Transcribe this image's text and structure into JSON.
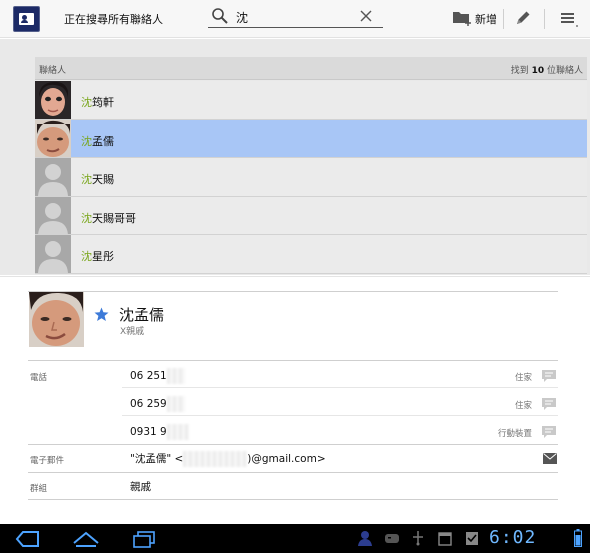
{
  "action_bar": {
    "title": "正在搜尋所有聯絡人",
    "search_query": "沈",
    "add_label": "新增"
  },
  "list": {
    "header_left": "聯絡人",
    "result_prefix": "找到 ",
    "result_count": "10",
    "result_suffix": " 位聯絡人",
    "contacts": [
      {
        "hl": "沈",
        "rest": "筠軒",
        "photo": "girl-photo"
      },
      {
        "hl": "沈",
        "rest": "孟儒",
        "photo": "man-photo"
      },
      {
        "hl": "沈",
        "rest": "天賜",
        "photo": "placeholder"
      },
      {
        "hl": "沈",
        "rest": "天賜哥哥",
        "photo": "placeholder"
      },
      {
        "hl": "沈",
        "rest": "星彤",
        "photo": "placeholder"
      }
    ]
  },
  "detail": {
    "name": "沈孟儒",
    "subtitle": "X親戚",
    "phone_label": "電話",
    "phones": [
      {
        "number": "06 251",
        "type": "住家"
      },
      {
        "number": "06 259",
        "type": "住家"
      },
      {
        "number": "0931 9",
        "type": "行動裝置"
      }
    ],
    "email_label": "電子郵件",
    "email_prefix": "\"沈孟儒\" <",
    "email_suffix": ")@gmail.com>",
    "group_label": "群組",
    "group_value": "親戚"
  },
  "system_bar": {
    "time": "6:02"
  },
  "colors": {
    "match_highlight": "#79a61a",
    "selected_row": "#a8c6f6",
    "star": "#3d7ad8",
    "clock": "#6fb8ff"
  },
  "icons": [
    "contacts-app-icon",
    "search-icon",
    "clear-icon",
    "add-group-icon",
    "edit-icon",
    "menu-icon",
    "star-icon",
    "sms-icon",
    "mail-icon",
    "back-icon",
    "home-icon",
    "recent-apps-icon"
  ]
}
